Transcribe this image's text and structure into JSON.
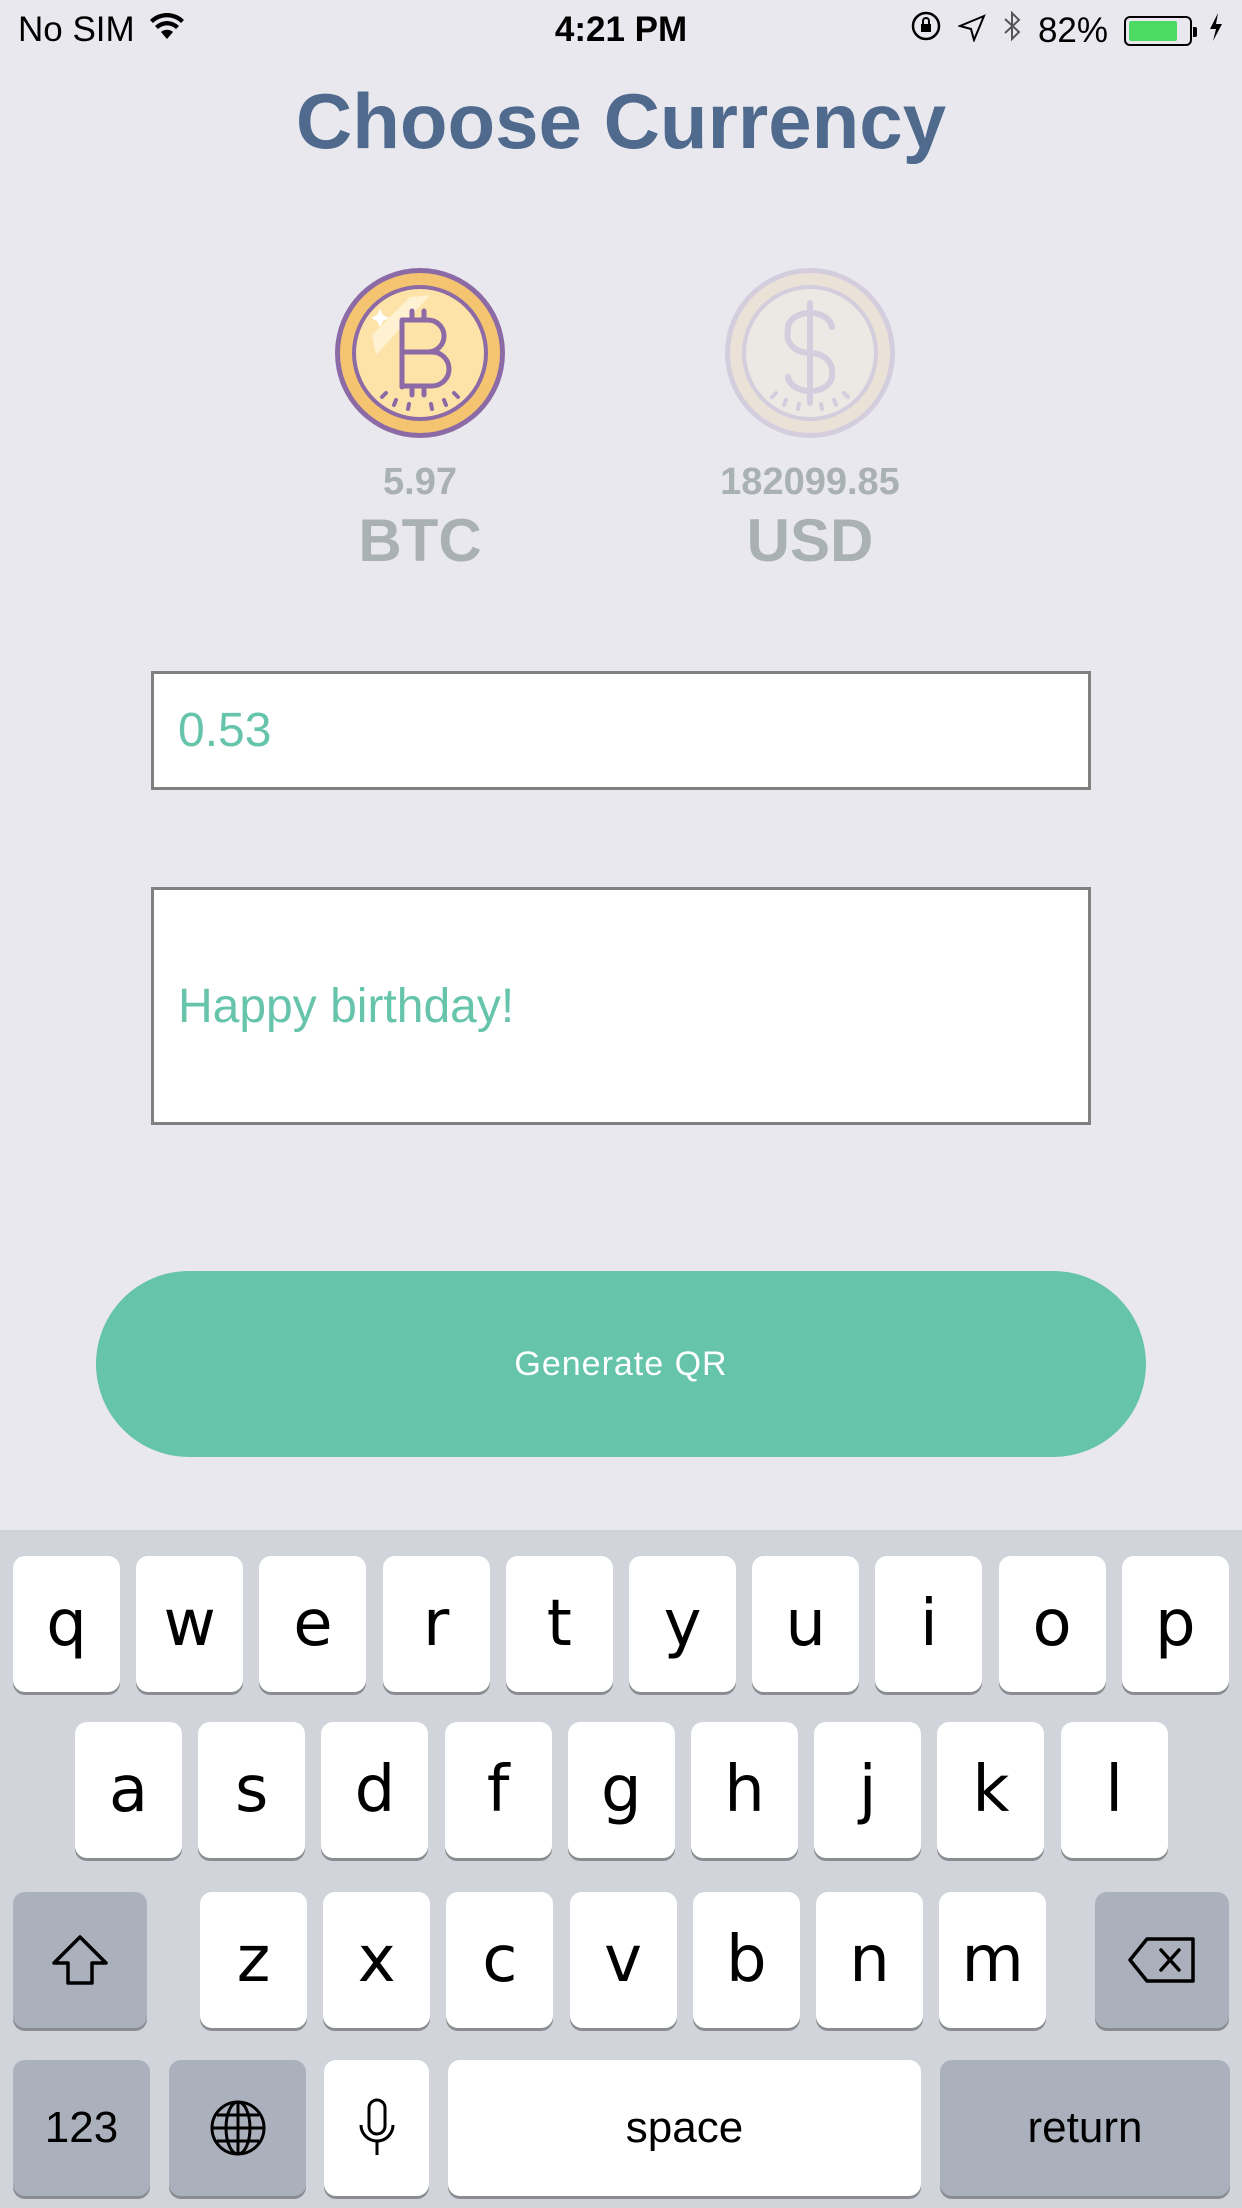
{
  "status_bar": {
    "carrier": "No SIM",
    "time": "4:21 PM",
    "battery_percent": "82%",
    "battery_level": 0.82,
    "icons": [
      "wifi-icon",
      "rotation-lock-icon",
      "location-icon",
      "bluetooth-icon",
      "battery-icon",
      "charging-icon"
    ]
  },
  "title": "Choose Currency",
  "currencies": [
    {
      "balance": "5.97",
      "code": "BTC",
      "icon": "bitcoin-coin-icon",
      "selected": true
    },
    {
      "balance": "182099.85",
      "code": "USD",
      "icon": "dollar-coin-icon",
      "selected": false
    }
  ],
  "form": {
    "amount_value": "0.53",
    "memo_value": "Happy birthday!"
  },
  "generate_button": {
    "label": "Generate QR"
  },
  "keyboard": {
    "row1": [
      "q",
      "w",
      "e",
      "r",
      "t",
      "y",
      "u",
      "i",
      "o",
      "p"
    ],
    "row2": [
      "a",
      "s",
      "d",
      "f",
      "g",
      "h",
      "j",
      "k",
      "l"
    ],
    "row3": [
      "z",
      "x",
      "c",
      "v",
      "b",
      "n",
      "m"
    ],
    "numbers_label": "123",
    "space_label": "space",
    "return_label": "return",
    "icons": [
      "shift-icon",
      "backspace-icon",
      "globe-icon",
      "microphone-icon"
    ]
  },
  "colors": {
    "background": "#e9e8ef",
    "title": "#4f6a8c",
    "accent": "#66c4ab",
    "muted_text": "#a9b1b3",
    "keyboard_bg": "#d1d4db"
  }
}
